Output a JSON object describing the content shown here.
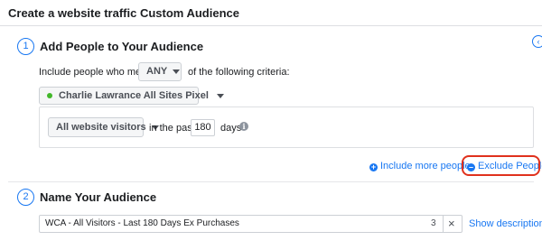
{
  "header": {
    "title": "Create a website traffic Custom Audience"
  },
  "collapse_icon": "chevron-left-icon",
  "step1": {
    "number": "1",
    "title": "Add People to Your Audience",
    "include_prefix": "Include people who meet",
    "match_select": "ANY",
    "include_suffix": "of the following criteria:",
    "pixel": {
      "label": "Charlie Lawrance All Sites Pixel",
      "status_color": "#42b72a"
    },
    "criteria": {
      "visitors_select": "All website visitors",
      "in_the_past": "in the past",
      "days_value": "180",
      "days_label": "days",
      "info_icon": "info-icon"
    },
    "include_more_link": "Include more people",
    "exclude_link": "Exclude People"
  },
  "step2": {
    "number": "2",
    "title": "Name Your Audience",
    "name_value": "WCA - All Visitors - Last 180 Days Ex Purchases",
    "char_count": "3",
    "clear_icon": "close-icon",
    "show_description": "Show description"
  },
  "colors": {
    "accent": "#1877f2",
    "highlight": "#e0311d"
  }
}
